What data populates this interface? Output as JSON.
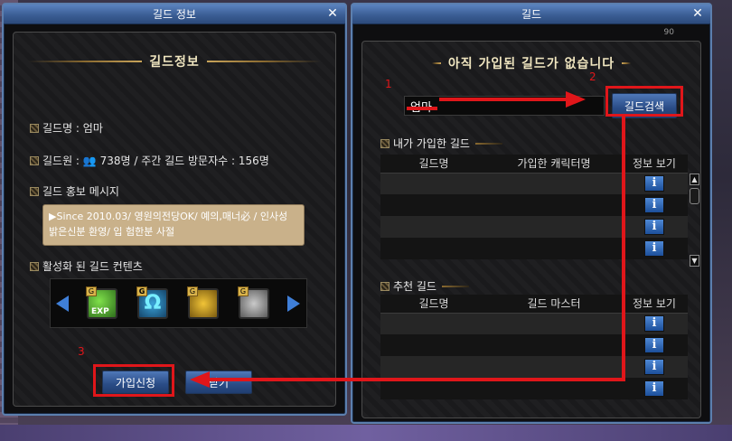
{
  "guild_info_window": {
    "title": "길드 정보",
    "banner": "길드정보",
    "guild_name_label": "길드명 : 엄마",
    "guild_members_count": "738명",
    "guild_weekly_visitors": "/ 주간 길드 방문자수 : 156명",
    "guild_members_prefix": "길드원 :",
    "promo_heading": "길드 홍보 메시지",
    "promo_message": "▶Since 2010.03/ 영원의전당OK/ 예의,매너必 / 인사성 밝은신분 환영/ 입 험한분 사절",
    "active_contents_heading": "활성화 된 길드 컨텐츠",
    "contents": [
      {
        "icon": "exp-boost-icon",
        "badge": "G",
        "label": "EXP"
      },
      {
        "icon": "omega-icon",
        "badge": "G",
        "label": "Ω"
      },
      {
        "icon": "golden-statue-icon",
        "badge": "G"
      },
      {
        "icon": "storage-box-icon",
        "badge": "G"
      }
    ],
    "join_button": "가입신청",
    "close_button": "닫기"
  },
  "guild_window": {
    "title": "길드",
    "banner": "아직 가입된 길드가 없습니다",
    "search_value": "엄마",
    "search_button": "길드검색",
    "my_guilds_heading": "내가 가입한 길드",
    "my_guilds_columns": [
      "길드명",
      "가입한 캐릭터명",
      "정보 보기"
    ],
    "my_guilds_rows": 4,
    "recommended_heading": "추천 길드",
    "recommended_columns": [
      "길드명",
      "길드 마스터",
      "정보 보기"
    ],
    "recommended_rows": 4,
    "info_glyph": "i"
  },
  "annotations": {
    "step1": "1",
    "step2": "2",
    "step3": "3",
    "color": "#e0161a"
  },
  "misc": {
    "corner_number": "90"
  }
}
